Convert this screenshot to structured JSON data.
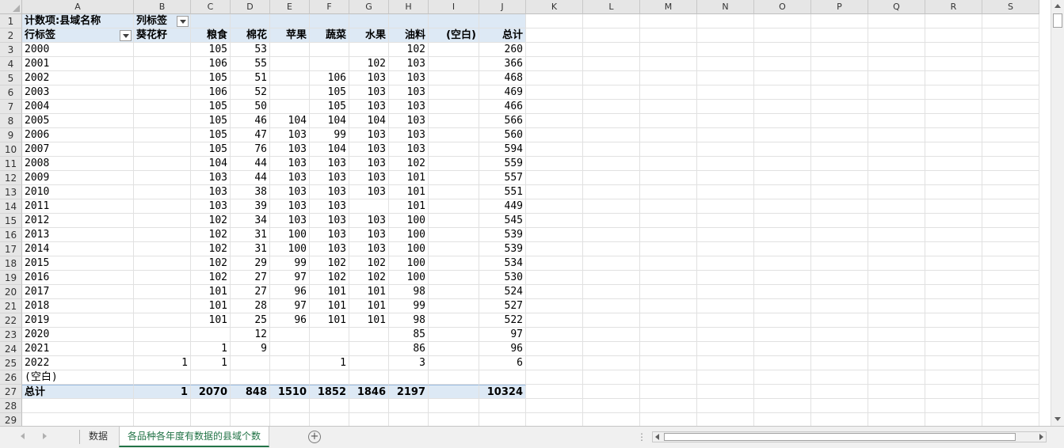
{
  "column_headers": [
    "A",
    "B",
    "C",
    "D",
    "E",
    "F",
    "G",
    "H",
    "I",
    "J",
    "K",
    "L",
    "M",
    "N",
    "O",
    "P",
    "Q",
    "R",
    "S"
  ],
  "pivot": {
    "value_field_label": "计数项:县域名称",
    "column_labels_label": "列标签",
    "row_labels_label": "行标签",
    "columns": [
      "葵花籽",
      "粮食",
      "棉花",
      "苹果",
      "蔬菜",
      "水果",
      "油料",
      "(空白)",
      "总计"
    ],
    "rows": [
      {
        "label": "2000",
        "values": [
          "",
          "105",
          "53",
          "",
          "",
          "",
          "102",
          "",
          "260"
        ]
      },
      {
        "label": "2001",
        "values": [
          "",
          "106",
          "55",
          "",
          "",
          "102",
          "103",
          "",
          "366"
        ]
      },
      {
        "label": "2002",
        "values": [
          "",
          "105",
          "51",
          "",
          "106",
          "103",
          "103",
          "",
          "468"
        ]
      },
      {
        "label": "2003",
        "values": [
          "",
          "106",
          "52",
          "",
          "105",
          "103",
          "103",
          "",
          "469"
        ]
      },
      {
        "label": "2004",
        "values": [
          "",
          "105",
          "50",
          "",
          "105",
          "103",
          "103",
          "",
          "466"
        ]
      },
      {
        "label": "2005",
        "values": [
          "",
          "105",
          "46",
          "104",
          "104",
          "104",
          "103",
          "",
          "566"
        ]
      },
      {
        "label": "2006",
        "values": [
          "",
          "105",
          "47",
          "103",
          "99",
          "103",
          "103",
          "",
          "560"
        ]
      },
      {
        "label": "2007",
        "values": [
          "",
          "105",
          "76",
          "103",
          "104",
          "103",
          "103",
          "",
          "594"
        ]
      },
      {
        "label": "2008",
        "values": [
          "",
          "104",
          "44",
          "103",
          "103",
          "103",
          "102",
          "",
          "559"
        ]
      },
      {
        "label": "2009",
        "values": [
          "",
          "103",
          "44",
          "103",
          "103",
          "103",
          "101",
          "",
          "557"
        ]
      },
      {
        "label": "2010",
        "values": [
          "",
          "103",
          "38",
          "103",
          "103",
          "103",
          "101",
          "",
          "551"
        ]
      },
      {
        "label": "2011",
        "values": [
          "",
          "103",
          "39",
          "103",
          "103",
          "",
          "101",
          "",
          "449"
        ]
      },
      {
        "label": "2012",
        "values": [
          "",
          "102",
          "34",
          "103",
          "103",
          "103",
          "100",
          "",
          "545"
        ]
      },
      {
        "label": "2013",
        "values": [
          "",
          "102",
          "31",
          "100",
          "103",
          "103",
          "100",
          "",
          "539"
        ]
      },
      {
        "label": "2014",
        "values": [
          "",
          "102",
          "31",
          "100",
          "103",
          "103",
          "100",
          "",
          "539"
        ]
      },
      {
        "label": "2015",
        "values": [
          "",
          "102",
          "29",
          "99",
          "102",
          "102",
          "100",
          "",
          "534"
        ]
      },
      {
        "label": "2016",
        "values": [
          "",
          "102",
          "27",
          "97",
          "102",
          "102",
          "100",
          "",
          "530"
        ]
      },
      {
        "label": "2017",
        "values": [
          "",
          "101",
          "27",
          "96",
          "101",
          "101",
          "98",
          "",
          "524"
        ]
      },
      {
        "label": "2018",
        "values": [
          "",
          "101",
          "28",
          "97",
          "101",
          "101",
          "99",
          "",
          "527"
        ]
      },
      {
        "label": "2019",
        "values": [
          "",
          "101",
          "25",
          "96",
          "101",
          "101",
          "98",
          "",
          "522"
        ]
      },
      {
        "label": "2020",
        "values": [
          "",
          "",
          "12",
          "",
          "",
          "",
          "85",
          "",
          "97"
        ]
      },
      {
        "label": "2021",
        "values": [
          "",
          "1",
          "9",
          "",
          "",
          "",
          "86",
          "",
          "96"
        ]
      },
      {
        "label": "2022",
        "values": [
          "1",
          "1",
          "",
          "",
          "1",
          "",
          "3",
          "",
          "6"
        ]
      },
      {
        "label": "(空白)",
        "values": [
          "",
          "",
          "",
          "",
          "",
          "",
          "",
          "",
          ""
        ]
      }
    ],
    "total_label": "总计",
    "totals": [
      "1",
      "2070",
      "848",
      "1510",
      "1852",
      "1846",
      "2197",
      "",
      "10324"
    ]
  },
  "tabs": [
    {
      "label": "数据",
      "active": false
    },
    {
      "label": "各品种各年度有数据的县域个数",
      "active": true
    }
  ],
  "colors": {
    "header_fill": "#dde9f5",
    "active_tab": "#217346"
  }
}
